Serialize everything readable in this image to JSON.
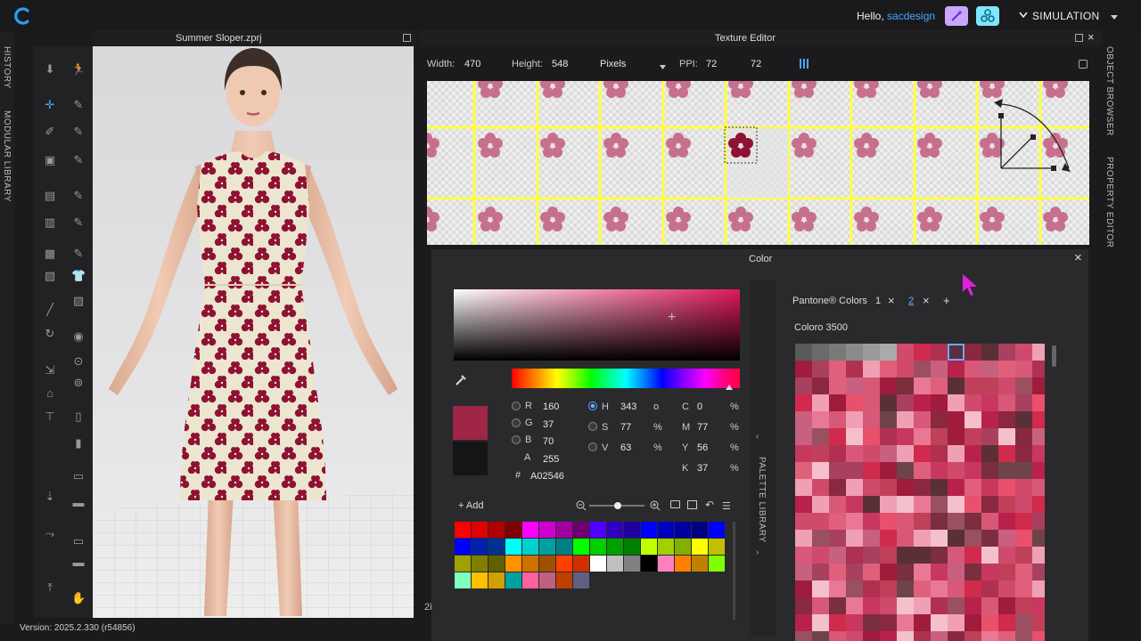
{
  "topbar": {
    "greeting": "Hello, ",
    "username": "sacdesign",
    "mode_label": "SIMULATION"
  },
  "left_tabs": {
    "history": "HISTORY",
    "modular_library": "MODULAR LIBRARY"
  },
  "viewport": {
    "title": "Summer Sloper.zprj"
  },
  "status": {
    "version": "Version: 2025.2.330 (r54856)"
  },
  "texture_editor": {
    "title": "Texture Editor",
    "width_label": "Width:",
    "width_value": "470",
    "height_label": "Height:",
    "height_value": "548",
    "unit": "Pixels",
    "ppi_label": "PPI:",
    "ppi_x": "72",
    "ppi_y": "72"
  },
  "right_tabs": {
    "object_browser": "OBJECT BROWSER",
    "property_editor": "PROPERTY EDITOR"
  },
  "color_dialog": {
    "title": "Color",
    "rgb": {
      "r_label": "R",
      "r": "160",
      "g_label": "G",
      "g": "37",
      "b_label": "B",
      "b": "70",
      "a_label": "A",
      "a": "255"
    },
    "hex_label": "#",
    "hex": "A02546",
    "hsv": {
      "h_label": "H",
      "h": "343",
      "h_unit": "o",
      "s_label": "S",
      "s": "77",
      "s_unit": "%",
      "v_label": "V",
      "v": "63",
      "v_unit": "%"
    },
    "cmyk": {
      "c_label": "C",
      "c": "0",
      "m_label": "M",
      "m": "77",
      "y_label": "Y",
      "y": "56",
      "k_label": "K",
      "k": "37",
      "unit": "%"
    },
    "add_label": "+ Add",
    "selected_color": "#A02546",
    "palette_library_label": "PALETTE LIBRARY",
    "pantone_label": "Pantone® Colors",
    "tab_1": "1",
    "tab_2": "2",
    "subset_label": "Coloro 3500",
    "palette_swatches": [
      "#ff0000",
      "#e00000",
      "#b00000",
      "#800000",
      "#ff00ff",
      "#d000d0",
      "#a000a0",
      "#700070",
      "#5000ff",
      "#3000c0",
      "#2000a0",
      "#0000ff",
      "#0000c0",
      "#0000a0",
      "#000080",
      "#0000ff",
      "#0000ff",
      "#0020b0",
      "#003090",
      "#00ffff",
      "#00d0d0",
      "#00a0a0",
      "#008080",
      "#00ff00",
      "#00d000",
      "#00a000",
      "#008000",
      "#c0ff00",
      "#a0d000",
      "#80b000",
      "#ffff00",
      "#c0c000",
      "#a0a000",
      "#808000",
      "#606000",
      "#ff9000",
      "#d07000",
      "#a05000",
      "#ff4000",
      "#d03000",
      "#ffffff",
      "#c0c0c0",
      "#808080",
      "#000000",
      "#ff80c0",
      "#ff8000",
      "#c08000",
      "#80ff00",
      "#80ffc0",
      "#ffc000",
      "#d0a000",
      "#00a0a0",
      "#ff60a0",
      "#c06080",
      "#c04000",
      "#606080"
    ],
    "selection_colors": {
      "accent": "#6aa8ff"
    }
  }
}
